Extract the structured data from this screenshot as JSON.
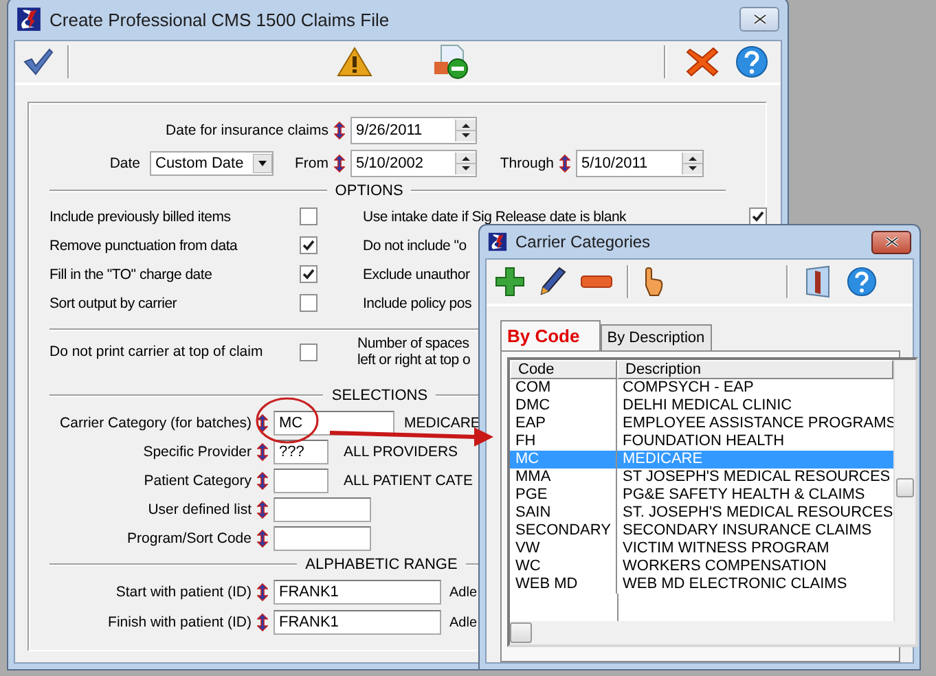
{
  "window": {
    "title": "Create Professional CMS 1500 Claims File"
  },
  "claims_date": {
    "label": "Date for insurance claims",
    "value": "9/26/2011"
  },
  "date_range": {
    "date_label": "Date",
    "date_choice": "Custom Date",
    "from_label": "From",
    "from": "5/10/2002",
    "through_label": "Through",
    "through": "5/10/2011"
  },
  "options": {
    "heading": "OPTIONS",
    "rows": [
      {
        "left": {
          "label": "Include previously billed items",
          "checked": false
        },
        "right": {
          "label": "Use intake date if Sig Release date is blank",
          "checked": true
        }
      },
      {
        "left": {
          "label": "Remove punctuation from data",
          "checked": true
        },
        "right": {
          "label": "Do not include \"o"
        }
      },
      {
        "left": {
          "label": "Fill in the \"TO\" charge date",
          "checked": true
        },
        "right": {
          "label": "Exclude unauthor"
        }
      },
      {
        "left": {
          "label": "Sort output by carrier",
          "checked": false
        },
        "right": {
          "label": "Include policy pos"
        }
      }
    ]
  },
  "print_carrier": {
    "label": "Do not print carrier at top of claim",
    "checked": false,
    "note_lines": [
      "Number of spaces",
      "left or right at top o"
    ]
  },
  "selections": {
    "heading": "SELECTIONS",
    "rows": [
      {
        "label": "Carrier Category (for batches)",
        "value": "MC",
        "description": "MEDICARE"
      },
      {
        "label": "Specific Provider",
        "value": "???",
        "description": "ALL PROVIDERS"
      },
      {
        "label": "Patient Category",
        "value": "",
        "description": "ALL PATIENT CATE"
      },
      {
        "label": "User defined list",
        "value": ""
      },
      {
        "label": "Program/Sort Code",
        "value": ""
      }
    ]
  },
  "alphabetic_range": {
    "heading": "ALPHABETIC RANGE",
    "rows": [
      {
        "label": "Start with patient (ID)",
        "value": "FRANK1",
        "description": "Adle"
      },
      {
        "label": "Finish with patient (ID)",
        "value": "FRANK1",
        "description": "Adle"
      }
    ]
  },
  "dialog": {
    "title": "Carrier Categories",
    "tabs": [
      {
        "label": "By Code",
        "selected": true
      },
      {
        "label": "By Description",
        "selected": false
      }
    ],
    "columns": [
      "Code",
      "Description"
    ],
    "rows": [
      {
        "code": "COM",
        "description": "COMPSYCH - EAP",
        "selected": false
      },
      {
        "code": "DMC",
        "description": "DELHI MEDICAL CLINIC",
        "selected": false
      },
      {
        "code": "EAP",
        "description": "EMPLOYEE ASSISTANCE PROGRAMS",
        "selected": false
      },
      {
        "code": "FH",
        "description": "FOUNDATION HEALTH",
        "selected": false
      },
      {
        "code": "MC",
        "description": "MEDICARE",
        "selected": true
      },
      {
        "code": "MMA",
        "description": "ST JOSEPH'S MEDICAL RESOURCES",
        "selected": false
      },
      {
        "code": "PGE",
        "description": "PG&E SAFETY HEALTH & CLAIMS",
        "selected": false
      },
      {
        "code": "SAIN",
        "description": "ST. JOSEPH'S MEDICAL RESOURCES",
        "selected": false
      },
      {
        "code": "SECONDARY",
        "description": "SECONDARY INSURANCE CLAIMS",
        "selected": false
      },
      {
        "code": "VW",
        "description": "VICTIM WITNESS PROGRAM",
        "selected": false
      },
      {
        "code": "WC",
        "description": "WORKERS COMPENSATION",
        "selected": false
      },
      {
        "code": "WEB MD",
        "description": "WEB MD ELECTRONIC CLAIMS",
        "selected": false
      }
    ]
  }
}
